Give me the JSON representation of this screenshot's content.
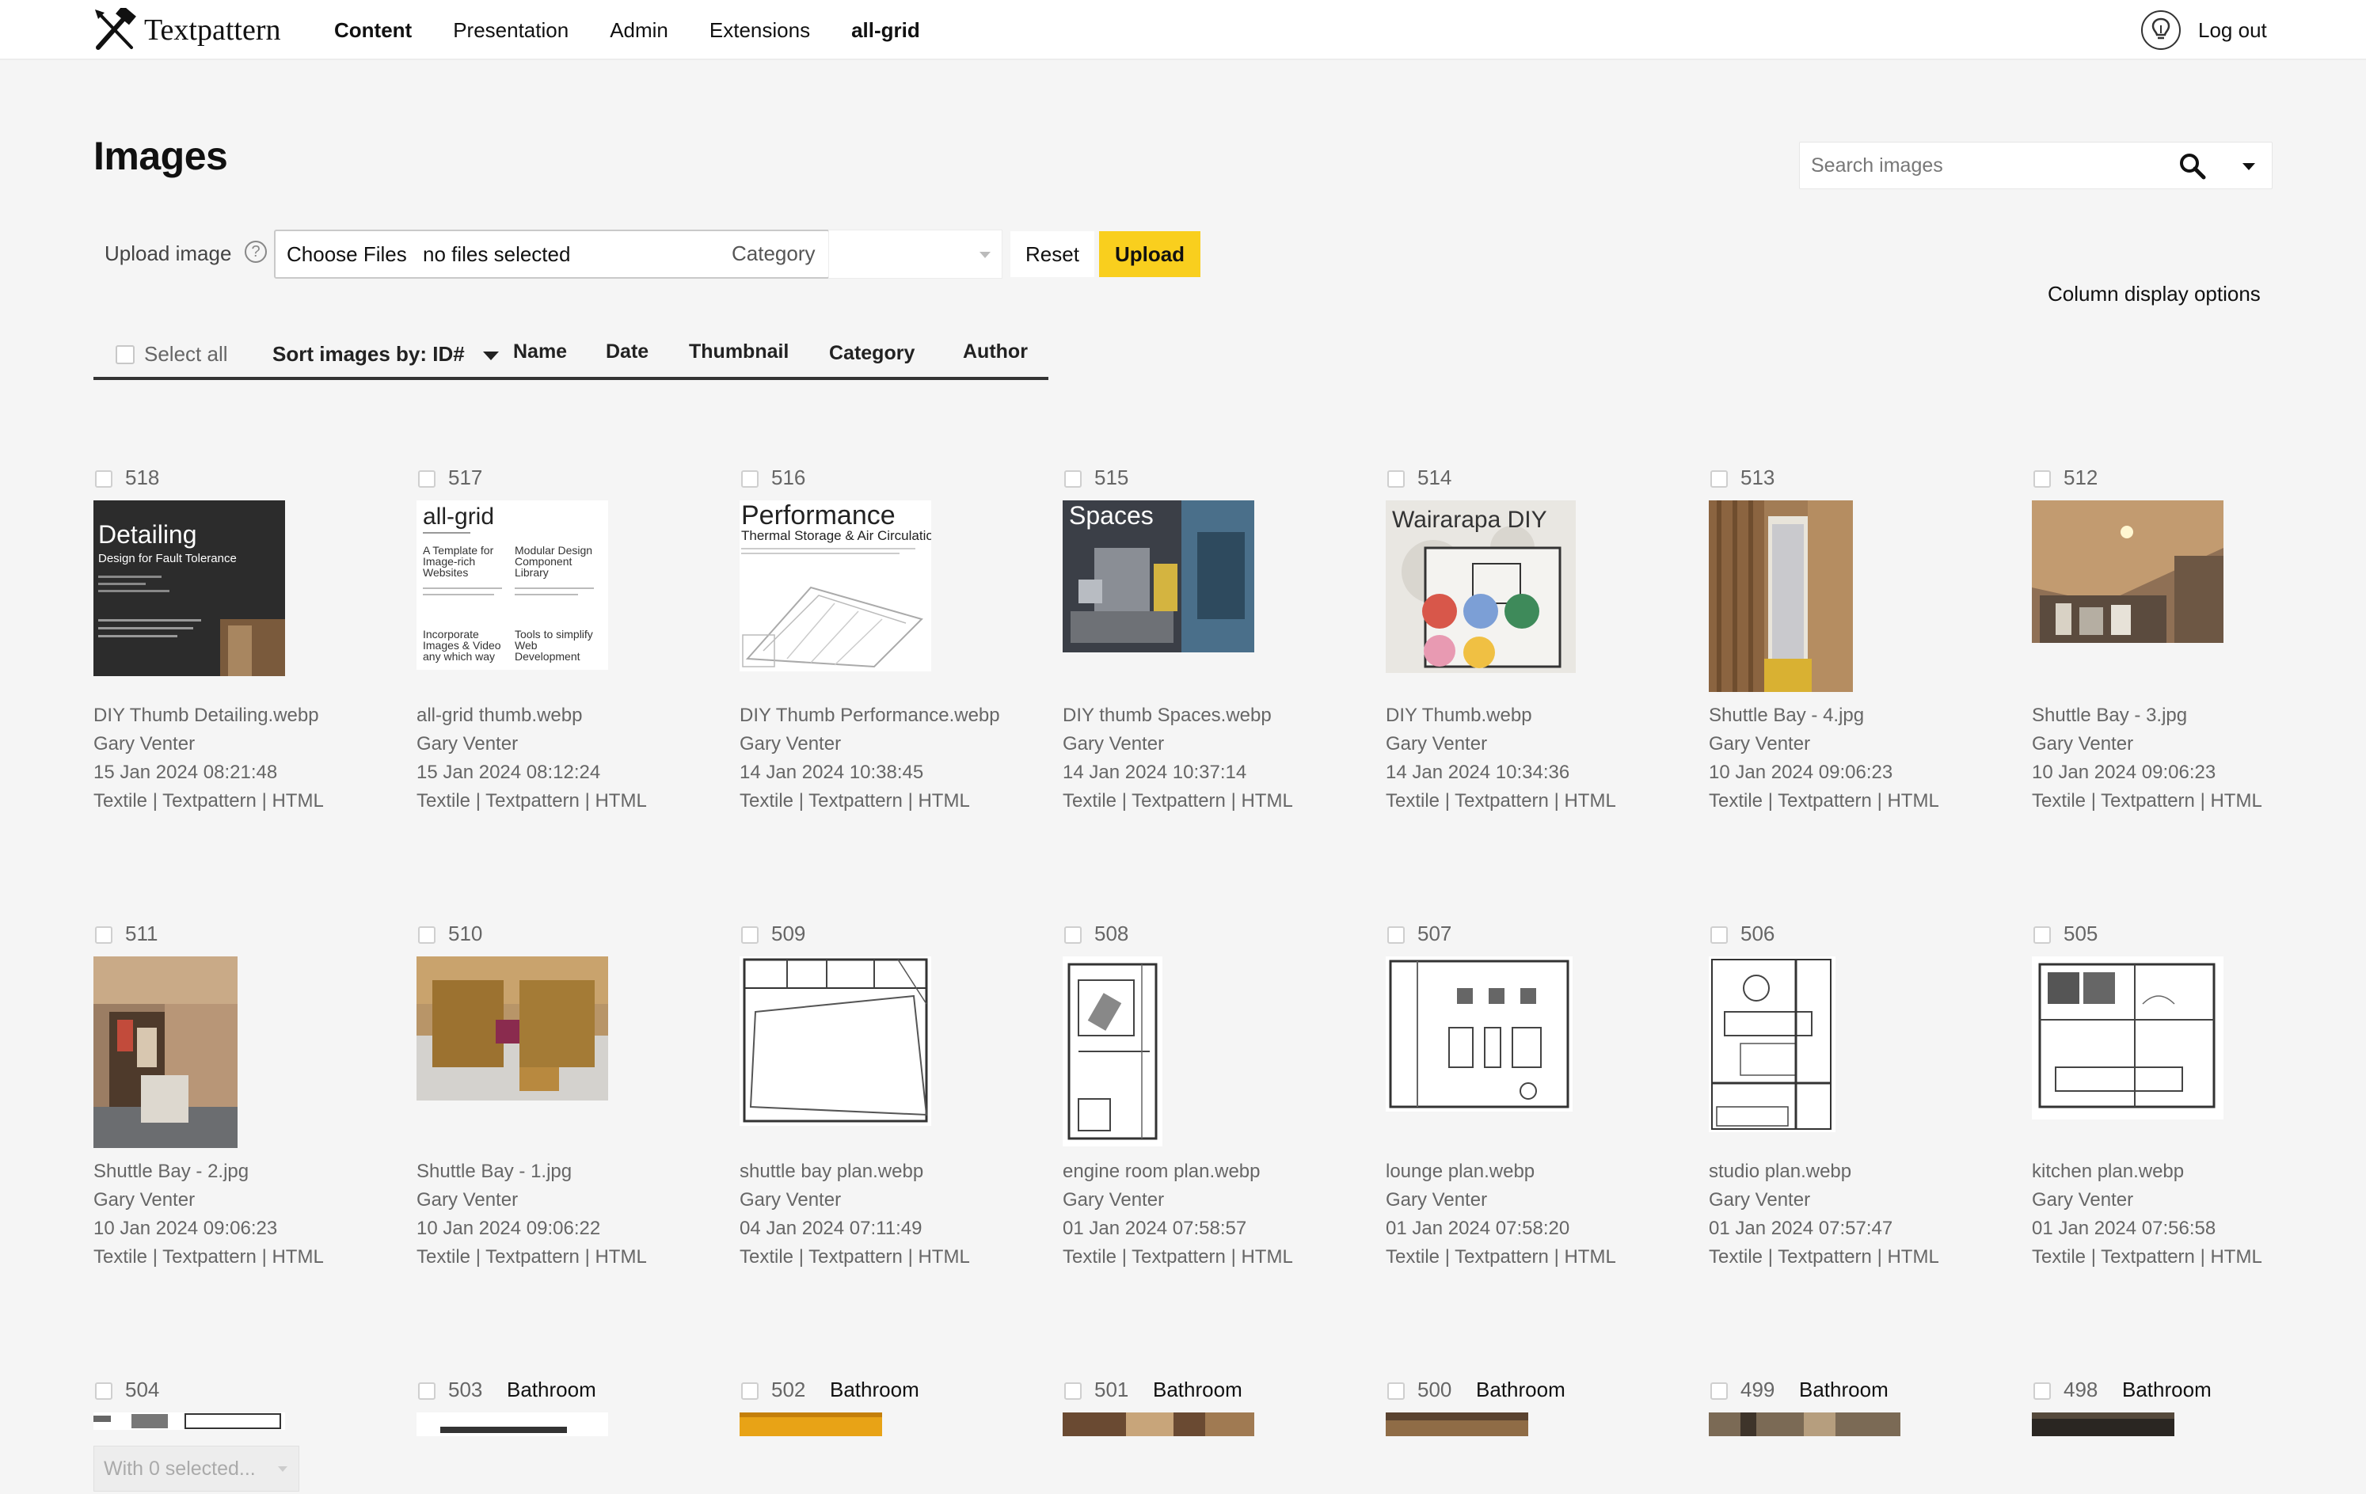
{
  "app": {
    "name": "Textpattern",
    "nav": [
      "Content",
      "Presentation",
      "Admin",
      "Extensions",
      "all-grid"
    ],
    "logout": "Log out"
  },
  "page": {
    "title": "Images",
    "search_placeholder": "Search images"
  },
  "upload": {
    "label": "Upload image",
    "help": "?",
    "choose_files": "Choose Files",
    "file_status": "no files selected",
    "category_label": "Category",
    "category_value": "",
    "reset": "Reset",
    "upload": "Upload"
  },
  "column_display": "Column display options",
  "sort": {
    "select_all": "Select all",
    "label": "Sort images by: ID#",
    "options": [
      "Name",
      "Date",
      "Thumbnail",
      "Category",
      "Author"
    ]
  },
  "images": [
    {
      "id": "518",
      "category": "",
      "name": "DIY Thumb Detailing.webp",
      "author": "Gary Venter",
      "date": "15 Jan 2024 08:21:48",
      "tags": "Textile | Textpattern | HTML",
      "thumb_text": "Detailing",
      "thumb_sub": "Design for Fault Tolerance"
    },
    {
      "id": "517",
      "category": "",
      "name": "all-grid thumb.webp",
      "author": "Gary Venter",
      "date": "15 Jan 2024 08:12:24",
      "tags": "Textile | Textpattern | HTML",
      "thumb_text": "all-grid"
    },
    {
      "id": "516",
      "category": "",
      "name": "DIY Thumb Performance.webp",
      "author": "Gary Venter",
      "date": "14 Jan 2024 10:38:45",
      "tags": "Textile | Textpattern | HTML",
      "thumb_text": "Performance",
      "thumb_sub": "Thermal Storage & Air Circulation"
    },
    {
      "id": "515",
      "category": "",
      "name": "DIY thumb Spaces.webp",
      "author": "Gary Venter",
      "date": "14 Jan 2024 10:37:14",
      "tags": "Textile | Textpattern | HTML",
      "thumb_text": "Spaces"
    },
    {
      "id": "514",
      "category": "",
      "name": "DIY Thumb.webp",
      "author": "Gary Venter",
      "date": "14 Jan 2024 10:34:36",
      "tags": "Textile | Textpattern | HTML",
      "thumb_text": "Wairarapa DIY"
    },
    {
      "id": "513",
      "category": "",
      "name": "Shuttle Bay - 4.jpg",
      "author": "Gary Venter",
      "date": "10 Jan 2024 09:06:23",
      "tags": "Textile | Textpattern | HTML"
    },
    {
      "id": "512",
      "category": "",
      "name": "Shuttle Bay - 3.jpg",
      "author": "Gary Venter",
      "date": "10 Jan 2024 09:06:23",
      "tags": "Textile | Textpattern | HTML"
    },
    {
      "id": "511",
      "category": "",
      "name": "Shuttle Bay - 2.jpg",
      "author": "Gary Venter",
      "date": "10 Jan 2024 09:06:23",
      "tags": "Textile | Textpattern | HTML"
    },
    {
      "id": "510",
      "category": "",
      "name": "Shuttle Bay - 1.jpg",
      "author": "Gary Venter",
      "date": "10 Jan 2024 09:06:22",
      "tags": "Textile | Textpattern | HTML"
    },
    {
      "id": "509",
      "category": "",
      "name": "shuttle bay plan.webp",
      "author": "Gary Venter",
      "date": "04 Jan 2024 07:11:49",
      "tags": "Textile | Textpattern | HTML"
    },
    {
      "id": "508",
      "category": "",
      "name": "engine room plan.webp",
      "author": "Gary Venter",
      "date": "01 Jan 2024 07:58:57",
      "tags": "Textile | Textpattern | HTML"
    },
    {
      "id": "507",
      "category": "",
      "name": "lounge plan.webp",
      "author": "Gary Venter",
      "date": "01 Jan 2024 07:58:20",
      "tags": "Textile | Textpattern | HTML"
    },
    {
      "id": "506",
      "category": "",
      "name": "studio plan.webp",
      "author": "Gary Venter",
      "date": "01 Jan 2024 07:57:47",
      "tags": "Textile | Textpattern | HTML"
    },
    {
      "id": "505",
      "category": "",
      "name": "kitchen plan.webp",
      "author": "Gary Venter",
      "date": "01 Jan 2024 07:56:58",
      "tags": "Textile | Textpattern | HTML"
    },
    {
      "id": "504",
      "category": ""
    },
    {
      "id": "503",
      "category": "Bathroom"
    },
    {
      "id": "502",
      "category": "Bathroom"
    },
    {
      "id": "501",
      "category": "Bathroom"
    },
    {
      "id": "500",
      "category": "Bathroom"
    },
    {
      "id": "499",
      "category": "Bathroom"
    },
    {
      "id": "498",
      "category": "Bathroom"
    }
  ],
  "with_selected": "With 0 selected...",
  "colors": {
    "accent": "#f9cf1e",
    "background": "#f5f5f5",
    "muted_text": "#666666"
  }
}
